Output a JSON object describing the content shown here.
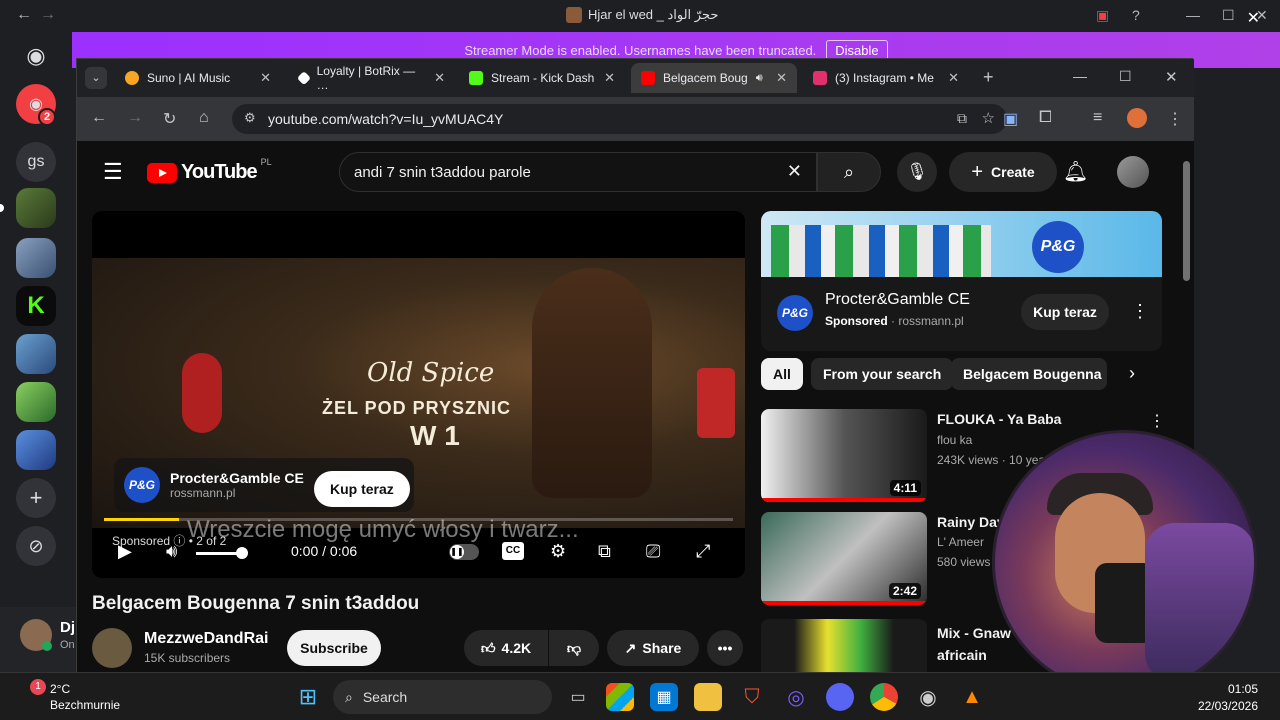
{
  "os_title": "Hjar el wed _ حجرّ الواد",
  "banner": {
    "text": "Streamer Mode is enabled. Usernames have been truncated.",
    "button": "Disable"
  },
  "discord": {
    "rail_label": "gs",
    "badge": "2",
    "user_initial": "Dj",
    "user_status": "On"
  },
  "tabs": [
    {
      "label": "Suno | AI Music",
      "color": "#f5a623"
    },
    {
      "label": "Loyalty | BotRix — …",
      "color": "#ffffff"
    },
    {
      "label": "Stream - Kick Dash",
      "color": "#53fc18"
    },
    {
      "label": "Belgacem Boug",
      "color": "#ff0000"
    },
    {
      "label": "(3) Instagram • Me",
      "color": "#e1306c"
    }
  ],
  "url": "youtube.com/watch?v=Iu_yvMUAC4Y",
  "youtube": {
    "logo": "YouTube",
    "region": "PL",
    "search_query": "andi 7 snin t3addou parole",
    "create_label": "Create",
    "player": {
      "brand": "Old Spice",
      "brand_sub": "ŻEL POD PRYSZNIC",
      "brand_sub2": "W 1",
      "advertiser": "Procter&Gamble CE",
      "advertiser_url": "rossmann.pl",
      "cta": "Kup teraz",
      "subtitle": "Wreszcie mogę umyć włosy i twarz...",
      "sponsored": "Sponsored",
      "ad_count": "• 2 of 2",
      "time": "0:00 / 0:06",
      "progress": 0.12,
      "volume": 0.85
    },
    "video_title": "Belgacem Bougenna 7 snin t3addou",
    "channel": "MezzweDandRai",
    "subscribers": "15K subscribers",
    "subscribe_label": "Subscribe",
    "likes": "4.2K",
    "share_label": "Share",
    "ad_side": {
      "name": "Procter&Gamble CE",
      "sponsored": "Sponsored",
      "site": "rossmann.pl",
      "cta": "Kup teraz",
      "logo_text": "P&G"
    },
    "chips": [
      "All",
      "From your search",
      "Belgacem Bougenna"
    ],
    "related": [
      {
        "title": "FLOUKA - Ya Baba",
        "channel": "flou ka",
        "meta": "243K views · 10 yea",
        "duration": "4:11"
      },
      {
        "title": "Rainy Day",
        "channel": "L' Ameer",
        "meta": "580 views",
        "duration": "2:42"
      },
      {
        "title": "Mix - Gnaw",
        "title2": "africain",
        "channel": "",
        "meta": "",
        "duration": ""
      }
    ]
  },
  "taskbar": {
    "weather_temp": "2°C",
    "weather_place": "Bezchmurnie",
    "search_label": "Search",
    "time": "01:05",
    "date": "22/03/2026"
  }
}
